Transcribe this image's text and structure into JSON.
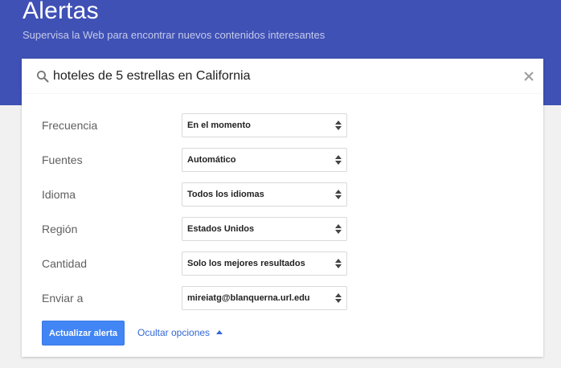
{
  "header": {
    "title": "Alertas",
    "subtitle": "Supervisa la Web para encontrar nuevos contenidos interesantes"
  },
  "search": {
    "value": "hoteles de 5 estrellas en California",
    "icon": "search-icon",
    "clear_icon": "close-icon"
  },
  "options": [
    {
      "label": "Frecuencia",
      "value": "En el momento"
    },
    {
      "label": "Fuentes",
      "value": "Automático"
    },
    {
      "label": "Idioma",
      "value": "Todos los idiomas"
    },
    {
      "label": "Región",
      "value": "Estados Unidos"
    },
    {
      "label": "Cantidad",
      "value": "Solo los mejores resultados"
    },
    {
      "label": "Enviar a",
      "value": "mireiatg@blanquerna.url.edu"
    }
  ],
  "actions": {
    "update_label": "Actualizar alerta",
    "hide_options_label": "Ocultar opciones"
  },
  "colors": {
    "header_bg": "#3f51b5",
    "primary_button": "#4285f4",
    "link": "#3367d6"
  }
}
